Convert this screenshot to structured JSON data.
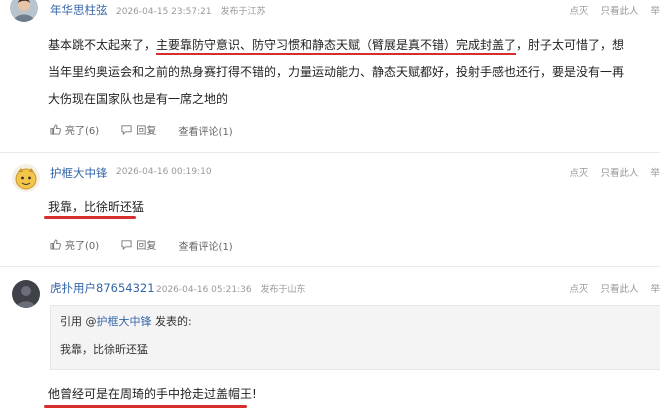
{
  "posts": [
    {
      "username": "年华思柱弦",
      "time": "2026-04-15 23:57:21",
      "location": "发布于江苏",
      "actions": {
        "down": "点灭",
        "see_only": "只看此人",
        "more": "举"
      },
      "body": {
        "line1_pre": "基本跳不太起来了，",
        "line1_ul": "主要靠防守意识、防守习惯和静态天赋（臂展是真不错）完成封盖了",
        "line1_post": "，肘子太可惜了，想",
        "line2": "当年里约奥运会和之前的热身赛打得不错的，力量运动能力、静态天赋都好，投射手感也还行，要是没有一再",
        "line3": "大伤现在国家队也是有一席之地的"
      },
      "bar": {
        "light": "亮了(6)",
        "reply": "回复",
        "view_replies": "查看评论(1)"
      }
    },
    {
      "username": "护框大中锋",
      "time": "2026-04-16 00:19:10",
      "actions": {
        "down": "点灭",
        "see_only": "只看此人",
        "more": "举"
      },
      "body": {
        "line1": "我靠，比徐昕还猛"
      },
      "bar": {
        "light": "亮了(0)",
        "reply": "回复",
        "view_replies": "查看评论(1)"
      }
    },
    {
      "username": "虎扑用户87654321",
      "time": "2026-04-16 05:21:36",
      "location": "发布于山东",
      "actions": {
        "down": "点灭",
        "see_only": "只看此人",
        "more": "举"
      },
      "quote": {
        "prefix": "引用 @",
        "user": "护框大中锋",
        "suffix": " 发表的:",
        "body": "我靠，比徐昕还猛",
        "more": "⋯"
      },
      "body": {
        "line1": "他曾经可是在周琦的手中抢走过盖帽王!"
      }
    }
  ],
  "colors": {
    "username": "#3466a8",
    "underline": "#d62d2d",
    "meta": "#9a9a9a"
  },
  "icons": [
    "thumb-up-icon",
    "reply-icon",
    "avatar-photo",
    "avatar-cartoon",
    "avatar-default"
  ]
}
